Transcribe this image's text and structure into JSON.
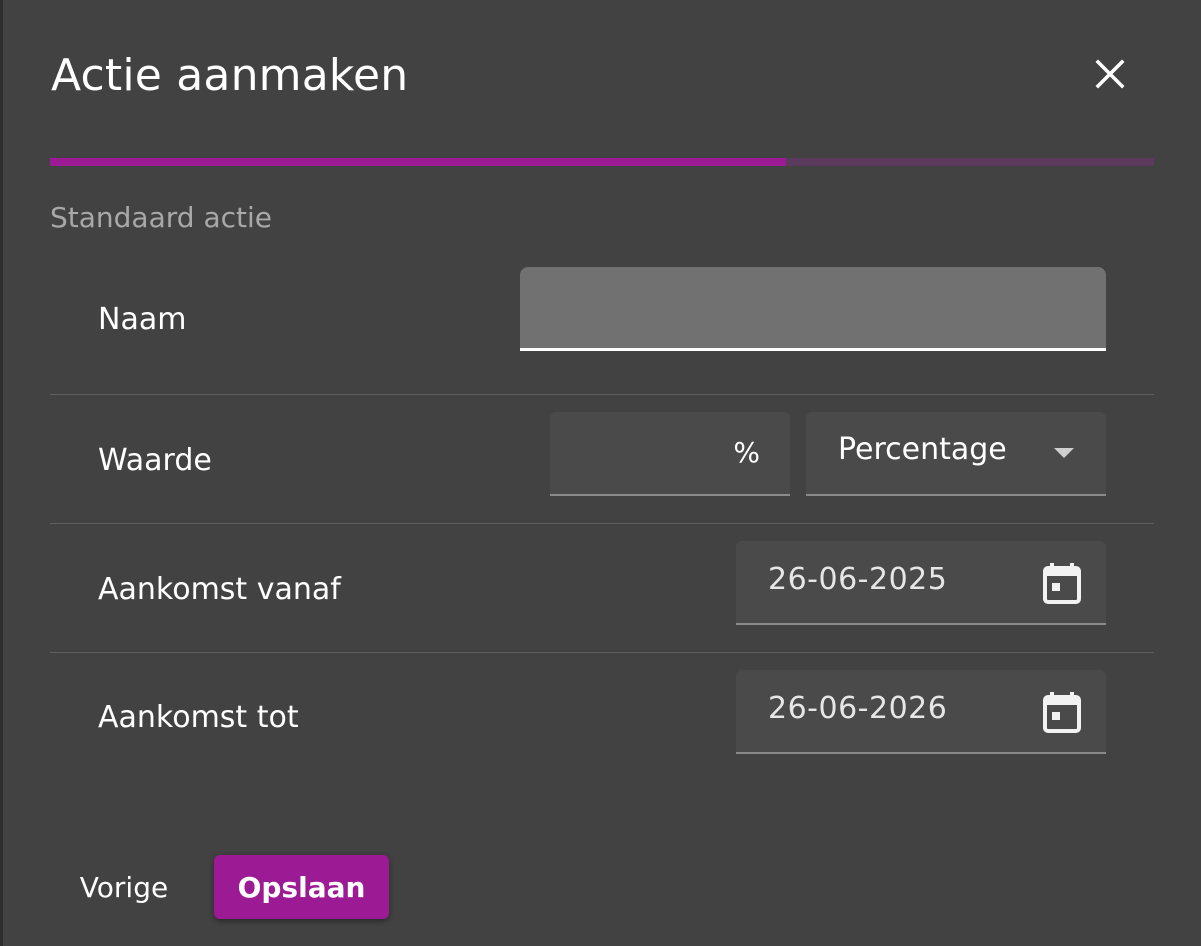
{
  "dialog": {
    "title": "Actie aanmaken",
    "step_progress": 0.667,
    "accent_color": "#9c1a94",
    "subtitle": "Standaard actie",
    "close_icon": "close-icon"
  },
  "form": {
    "naam": {
      "label": "Naam",
      "value": ""
    },
    "waarde": {
      "label": "Waarde",
      "value": "",
      "suffix": "%",
      "type_selected": "Percentage"
    },
    "aankomst_vanaf": {
      "label": "Aankomst vanaf",
      "value": "26-06-2025",
      "icon": "calendar-icon"
    },
    "aankomst_tot": {
      "label": "Aankomst tot",
      "value": "26-06-2026",
      "icon": "calendar-icon"
    }
  },
  "actions": {
    "prev_label": "Vorige",
    "save_label": "Opslaan"
  }
}
